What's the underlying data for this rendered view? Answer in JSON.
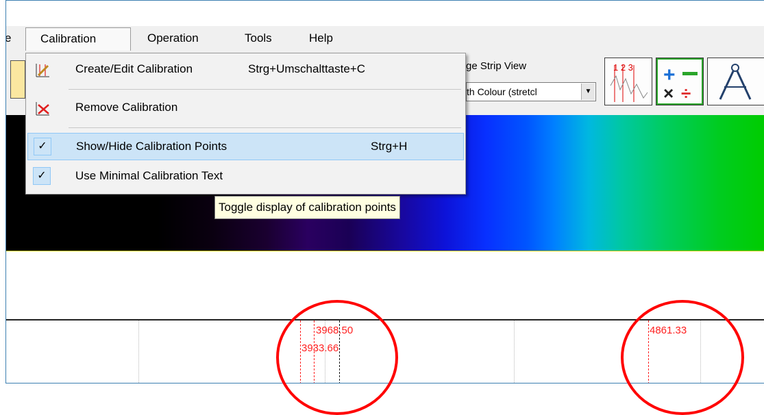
{
  "menubar": {
    "partial_left": "e",
    "items": [
      {
        "label": "Calibration"
      },
      {
        "label": "Operation"
      },
      {
        "label": "Tools"
      },
      {
        "label": "Help"
      }
    ]
  },
  "toolbar": {
    "strip_view_label": "ge Strip View",
    "strip_view_value": "th Colour (stretcl"
  },
  "dropdown": {
    "items": [
      {
        "label": "Create/Edit Calibration",
        "shortcut": "Strg+Umschalttaste+C",
        "icon": "pencil-chart-icon",
        "checked": false
      },
      {
        "label": "Remove Calibration",
        "shortcut": "",
        "icon": "red-x-chart-icon",
        "checked": false
      },
      {
        "label": "Show/Hide Calibration Points",
        "shortcut": "Strg+H",
        "icon": "checkmark-icon",
        "checked": true
      },
      {
        "label": "Use Minimal Calibration Text",
        "shortcut": "",
        "icon": "checkmark-icon",
        "checked": true
      }
    ]
  },
  "tooltip": {
    "text": "Toggle display of calibration points"
  },
  "plot": {
    "labels": [
      "3968.50",
      "3933.66",
      "4861.33"
    ]
  },
  "colors": {
    "highlight": "#cce4f7",
    "highlight_border": "#90c8f6",
    "annotation_red": "#ff0000",
    "window_border": "#3c7fb1"
  }
}
